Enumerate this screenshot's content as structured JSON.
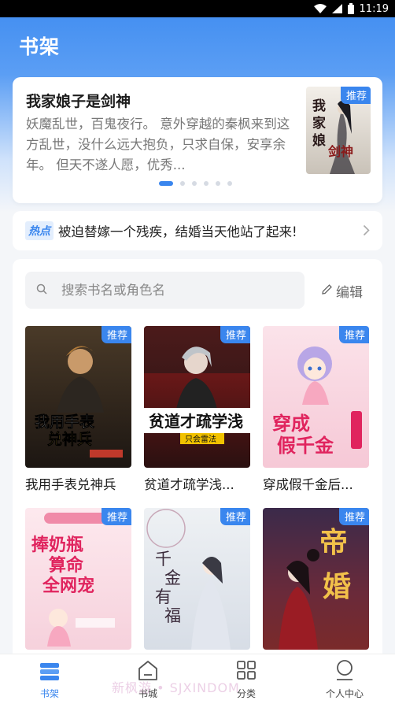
{
  "status": {
    "time": "11:19"
  },
  "header": {
    "title": "书架"
  },
  "recommend": {
    "title": "我家娘子是剑神",
    "description": "妖魔乱世，百鬼夜行。 意外穿越的秦枫来到这方乱世，没什么远大抱负，只求自保，安享余年。 但天不遂人愿，优秀...",
    "badge": "推荐",
    "cover_text": "我家娘子是剑神",
    "carousel_count": 6,
    "carousel_active": 1
  },
  "hot": {
    "tag": "热点",
    "text": "被迫替嫁一个残疾，结婚当天他站了起来!"
  },
  "shelf": {
    "search_placeholder": "搜索书名或角色名",
    "edit_label": "编辑",
    "books": [
      {
        "title": "我用手表兑神兵",
        "badge": "推荐",
        "cover_text": "我用手表兑神兵",
        "cover_colors": [
          "#4a3a28",
          "#1c1612"
        ]
      },
      {
        "title": "贫道才疏学浅...",
        "badge": "推荐",
        "cover_text": "贫道才疏学浅",
        "cover_colors": [
          "#8a1c1c",
          "#2a1010"
        ]
      },
      {
        "title": "穿成假千金后...",
        "badge": "推荐",
        "cover_text": "穿成假千金",
        "cover_colors": [
          "#fbe3ea",
          "#f6c8d6"
        ]
      },
      {
        "title": "",
        "badge": "推荐",
        "cover_text": "捧奶瓶算命全网宠",
        "cover_colors": [
          "#fde9ee",
          "#f6d1dc"
        ]
      },
      {
        "title": "",
        "badge": "推荐",
        "cover_text": "千金有福",
        "cover_colors": [
          "#eef1f4",
          "#d7dde6"
        ]
      },
      {
        "title": "",
        "badge": "推荐",
        "cover_text": "帝婚",
        "cover_colors": [
          "#3b2a4a",
          "#7a2a2a"
        ]
      }
    ]
  },
  "nav": {
    "items": [
      {
        "label": "书架",
        "icon": "bookshelf-icon"
      },
      {
        "label": "书城",
        "icon": "home-icon"
      },
      {
        "label": "分类",
        "icon": "grid-icon"
      },
      {
        "label": "个人中心",
        "icon": "user-icon"
      }
    ]
  },
  "watermark": "新枫游 • SJXINDOM",
  "colors": {
    "accent": "#3a86ee",
    "header": "#3f8cf1"
  }
}
